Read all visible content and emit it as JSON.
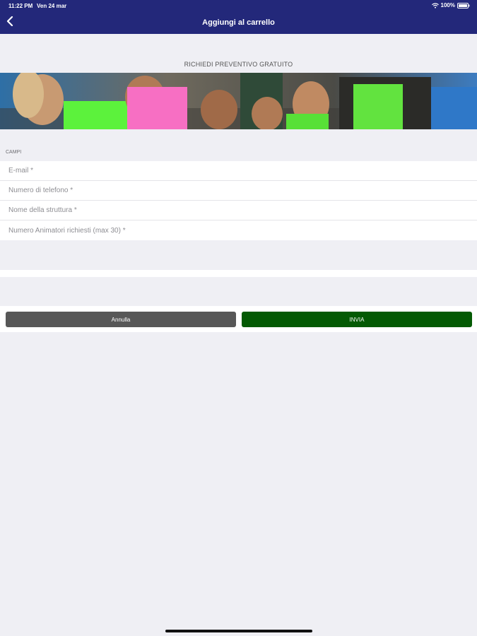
{
  "status_bar": {
    "time": "11:22 PM",
    "date": "Ven 24 mar",
    "battery": "100%"
  },
  "nav": {
    "title": "Aggiungi al carrello",
    "back_icon": "chevron-left-icon"
  },
  "section_title": "RICHIEDI PREVENTIVO GRATUITO",
  "fields_header": "CAMPI",
  "fields": [
    {
      "placeholder": "E-mail *",
      "value": ""
    },
    {
      "placeholder": "Numero di telefono *",
      "value": ""
    },
    {
      "placeholder": "Nome della struttura *",
      "value": ""
    },
    {
      "placeholder": "Numero Animatori richiesti (max 30) *",
      "value": ""
    }
  ],
  "buttons": {
    "cancel_label": "Annulla",
    "send_label": "INVIA"
  },
  "colors": {
    "header_bg": "#23287a",
    "cancel_bg": "#575757",
    "send_bg": "#045a04",
    "page_bg": "#efeff4"
  }
}
